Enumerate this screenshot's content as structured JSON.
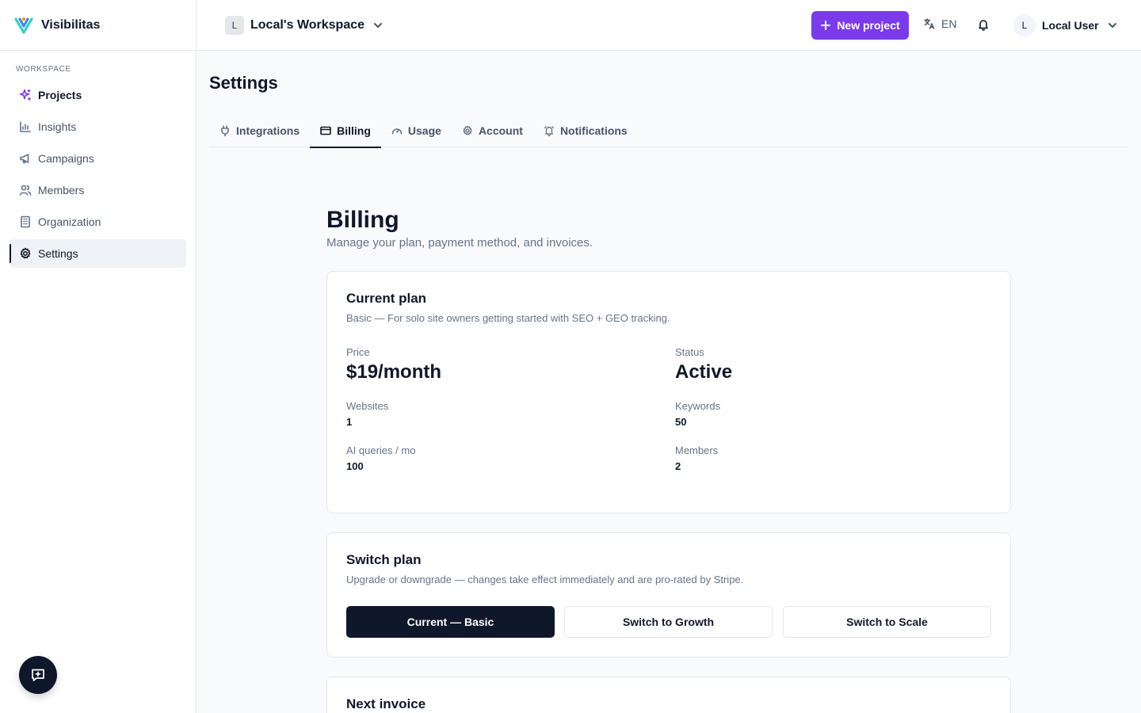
{
  "brand": {
    "name": "Visibilitas"
  },
  "sidebar": {
    "section_label": "WORKSPACE",
    "items": [
      {
        "label": "Projects",
        "icon": "sparkles-icon"
      },
      {
        "label": "Insights",
        "icon": "bar-chart-icon"
      },
      {
        "label": "Campaigns",
        "icon": "megaphone-icon"
      },
      {
        "label": "Members",
        "icon": "users-icon"
      },
      {
        "label": "Organization",
        "icon": "building-icon"
      },
      {
        "label": "Settings",
        "icon": "gear-icon",
        "active": true
      }
    ]
  },
  "header": {
    "workspace_badge": "L",
    "workspace_name": "Local's Workspace",
    "new_project_label": "New project",
    "language": "EN",
    "user_avatar": "L",
    "user_name": "Local User"
  },
  "page": {
    "title": "Settings",
    "tabs": [
      {
        "label": "Integrations",
        "icon": "plug-icon"
      },
      {
        "label": "Billing",
        "icon": "credit-card-icon",
        "active": true
      },
      {
        "label": "Usage",
        "icon": "gauge-icon"
      },
      {
        "label": "Account",
        "icon": "gear-icon"
      },
      {
        "label": "Notifications",
        "icon": "bell-icon"
      }
    ]
  },
  "billing": {
    "title": "Billing",
    "subtitle": "Manage your plan, payment method, and invoices.",
    "current_plan": {
      "title": "Current plan",
      "description": "Basic — For solo site owners getting started with SEO + GEO tracking.",
      "price_label": "Price",
      "price_value": "$19/month",
      "status_label": "Status",
      "status_value": "Active",
      "websites_label": "Websites",
      "websites_value": "1",
      "keywords_label": "Keywords",
      "keywords_value": "50",
      "ai_queries_label": "AI queries / mo",
      "ai_queries_value": "100",
      "members_label": "Members",
      "members_value": "2"
    },
    "switch_plan": {
      "title": "Switch plan",
      "description": "Upgrade or downgrade — changes take effect immediately and are pro-rated by Stripe.",
      "buttons": [
        "Current — Basic",
        "Switch to Growth",
        "Switch to Scale"
      ]
    },
    "next_invoice": {
      "title": "Next invoice"
    }
  },
  "colors": {
    "accent": "#7c3aed",
    "dark": "#0f172a",
    "muted": "#64748b",
    "border": "#e5e7eb"
  }
}
